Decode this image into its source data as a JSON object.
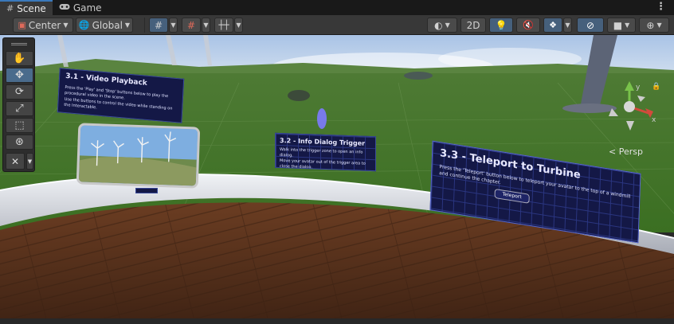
{
  "tabs": [
    {
      "label": "Scene",
      "icon": "grid-icon",
      "active": true
    },
    {
      "label": "Game",
      "icon": "gamepad-icon",
      "active": false
    }
  ],
  "toolbar": {
    "pivot": "Center",
    "space": "Global",
    "view_2d": "2D"
  },
  "tools": [
    "hand",
    "move",
    "rotate",
    "scale",
    "rect",
    "transform",
    "custom"
  ],
  "panels": {
    "video": {
      "title": "3.1 - Video Playback",
      "lines": [
        "Press the 'Play' and 'Stop' buttons below to play the procedural video in the scene.",
        "Use the buttons to control the video while standing on the Interactable."
      ]
    },
    "dialog": {
      "title": "3.2 - Info Dialog Trigger",
      "lines": [
        "Walk into the trigger zone to open an info dialog.",
        "Move your avatar out of the trigger area to close the dialog."
      ]
    },
    "teleport": {
      "title": "3.3 - Teleport to Turbine",
      "lines": [
        "Press the 'Teleport' button below to teleport your avatar to the top of a windmill and continue the chapter."
      ],
      "button": "Teleport"
    }
  },
  "gizmo": {
    "x": "x",
    "y": "y"
  },
  "camera_mode": "< Persp",
  "colors": {
    "accent": "#3a79bb",
    "panel_bg": "#141846",
    "sky": "#8fb0dc",
    "grass": "#4f8a2e"
  }
}
